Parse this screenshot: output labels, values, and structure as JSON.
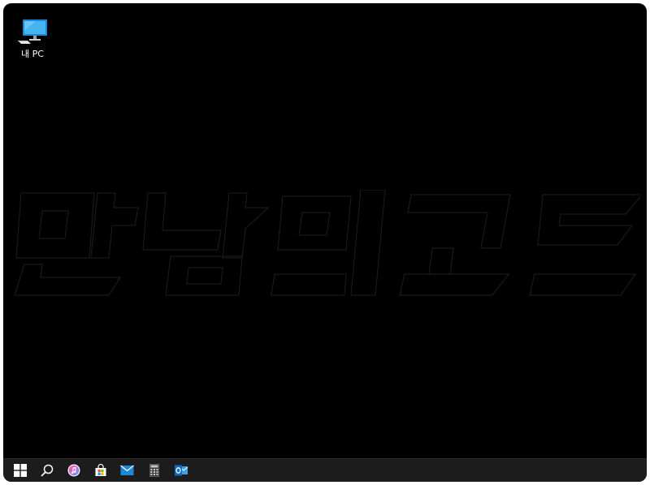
{
  "desktop": {
    "icons": [
      {
        "label": "내 PC",
        "icon": "monitor-icon"
      }
    ],
    "wallpaper": {
      "text": "만남의코드",
      "stroke_color": "#1a1a1a"
    }
  },
  "taskbar": {
    "background": "#1c1c1c",
    "items": [
      {
        "icon": "windows-start-icon"
      },
      {
        "icon": "search-icon"
      },
      {
        "icon": "itunes-icon"
      },
      {
        "icon": "store-icon"
      },
      {
        "icon": "mail-icon"
      },
      {
        "icon": "calculator-icon"
      },
      {
        "icon": "outlook-icon"
      }
    ]
  }
}
